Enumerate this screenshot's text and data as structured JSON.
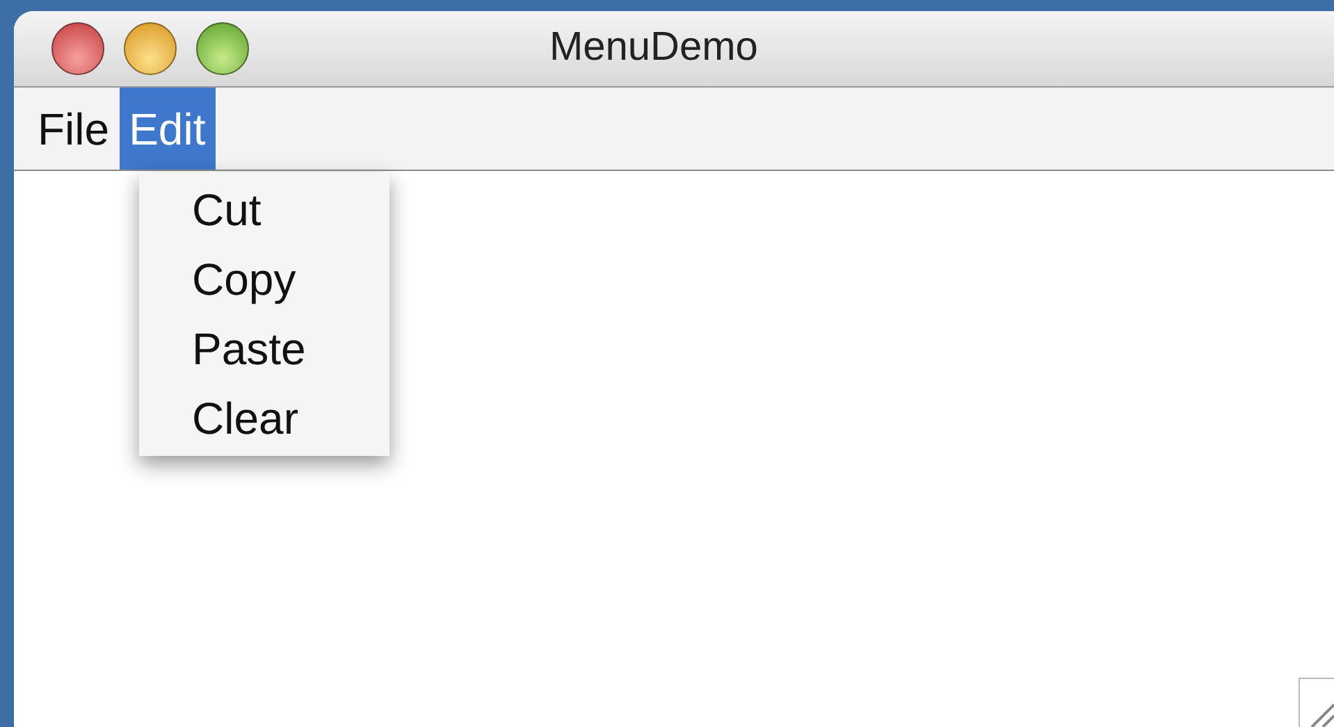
{
  "window": {
    "title": "MenuDemo"
  },
  "menu_bar": [
    {
      "label": "File",
      "selected": false
    },
    {
      "label": "Edit",
      "selected": true
    }
  ],
  "open_menu": {
    "items": [
      "Cut",
      "Copy",
      "Paste",
      "Clear"
    ]
  }
}
